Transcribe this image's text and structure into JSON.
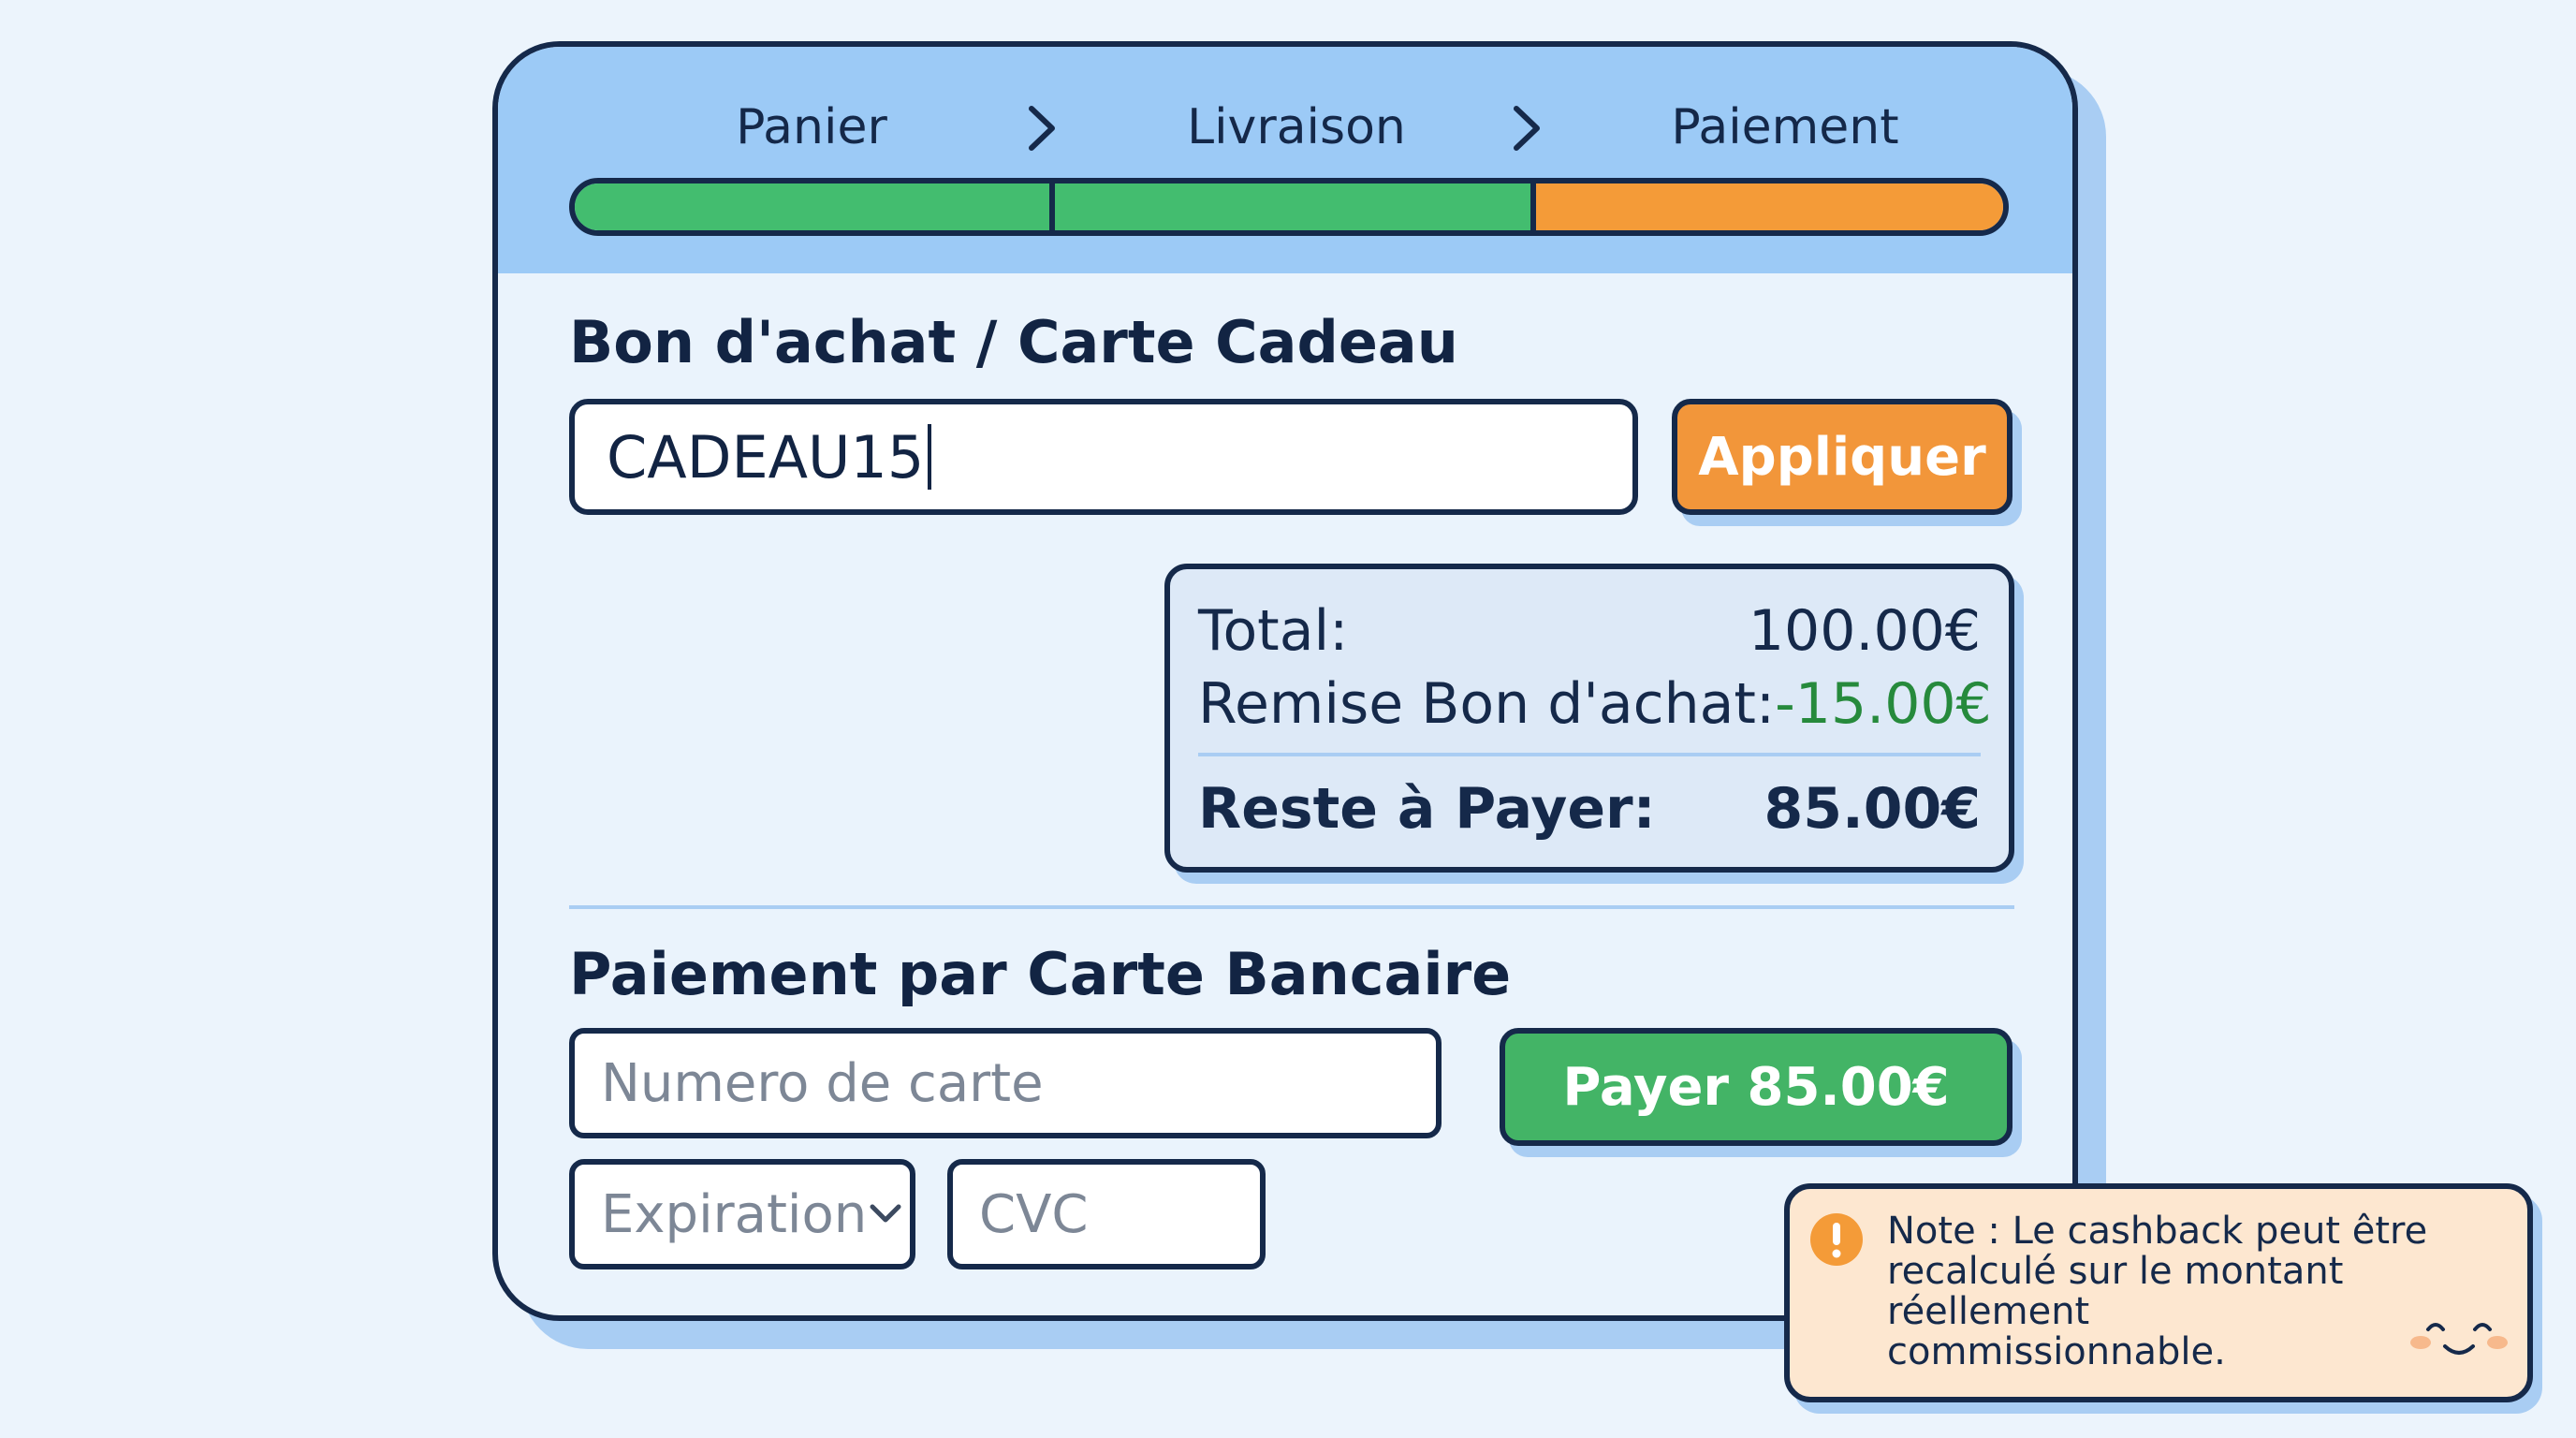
{
  "steps": [
    {
      "label": "Panier",
      "status": "done"
    },
    {
      "label": "Livraison",
      "status": "done"
    },
    {
      "label": "Paiement",
      "status": "current"
    }
  ],
  "colors": {
    "done": "#43bd6f",
    "current": "#f49b38",
    "header": "#9ccaf6",
    "apply_button": "#f2963a",
    "pay_button": "#43b466",
    "discount": "#268a3c",
    "note_bg": "#fde7d0"
  },
  "voucher": {
    "title": "Bon d'achat / Carte Cadeau",
    "code_value": "CADEAU15",
    "apply_label": "Appliquer"
  },
  "summary": {
    "total_label": "Total:",
    "total_value": "100.00€",
    "discount_label": "Remise Bon d'achat:",
    "discount_value": "-15.00€",
    "remaining_label": "Reste à Payer:",
    "remaining_value": "85.00€"
  },
  "card_payment": {
    "title": "Paiement par Carte Bancaire",
    "number_placeholder": "Numero de carte",
    "expiration_placeholder": "Expiration",
    "cvc_placeholder": "CVC",
    "pay_label": "Payer 85.00€"
  },
  "note": {
    "text": "Note : Le cashback peut être recalculé sur le montant réellement commissionnable."
  },
  "icons": {
    "step_separator": "chevron-right-icon",
    "select": "chevron-down-icon",
    "info": "info-icon",
    "mascot": "smiley-face-icon"
  }
}
